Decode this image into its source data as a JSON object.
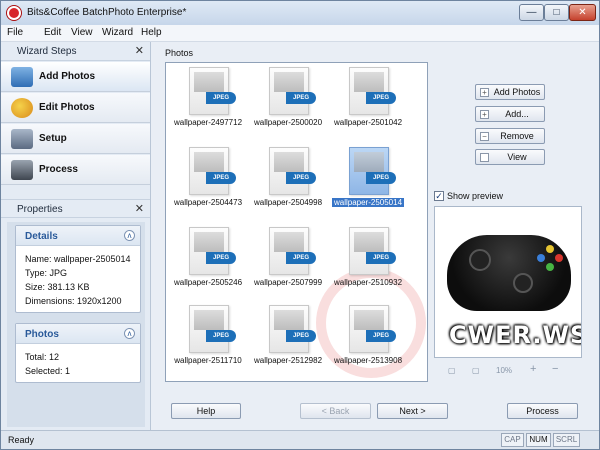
{
  "window": {
    "title": "Bits&Coffee BatchPhoto Enterprise*",
    "min_glyph": "—",
    "max_glyph": "□",
    "close_glyph": "✕"
  },
  "menu": [
    "File",
    "Edit",
    "View",
    "Wizard",
    "Help"
  ],
  "wizard_steps": {
    "title": "Wizard Steps",
    "close_glyph": "✕",
    "steps": [
      {
        "label": "Add Photos",
        "icon": "add-photos-icon",
        "active": true
      },
      {
        "label": "Edit Photos",
        "icon": "edit-photos-icon",
        "active": false
      },
      {
        "label": "Setup",
        "icon": "setup-icon",
        "active": false
      },
      {
        "label": "Process",
        "icon": "process-icon",
        "active": false
      }
    ]
  },
  "properties": {
    "title": "Properties",
    "close_glyph": "✕",
    "details": {
      "title": "Details",
      "collapse_glyph": "ʌ",
      "name": "Name: wallpaper-2505014",
      "type": "Type: JPG",
      "size": "Size: 381.13 KB",
      "dimensions": "Dimensions: 1920x1200"
    },
    "photos": {
      "title": "Photos",
      "collapse_glyph": "ʌ",
      "total": "Total: 12",
      "selected": "Selected: 1"
    }
  },
  "photos": {
    "label": "Photos",
    "badge": "JPEG",
    "items": [
      {
        "name": "wallpaper-2497712",
        "selected": false
      },
      {
        "name": "wallpaper-2500020",
        "selected": false
      },
      {
        "name": "wallpaper-2501042",
        "selected": false
      },
      {
        "name": "wallpaper-2504473",
        "selected": false
      },
      {
        "name": "wallpaper-2504998",
        "selected": false
      },
      {
        "name": "wallpaper-2505014",
        "selected": true
      },
      {
        "name": "wallpaper-2505246",
        "selected": false
      },
      {
        "name": "wallpaper-2507999",
        "selected": false
      },
      {
        "name": "wallpaper-2510932",
        "selected": false
      },
      {
        "name": "wallpaper-2511710",
        "selected": false
      },
      {
        "name": "wallpaper-2512982",
        "selected": false
      },
      {
        "name": "wallpaper-2513908",
        "selected": false
      }
    ]
  },
  "actions": {
    "add_photos": "Add Photos",
    "add": "Add...",
    "remove": "Remove",
    "view": "View"
  },
  "preview": {
    "show_label": "Show preview",
    "checked": true,
    "watermark": "CWER.WS",
    "zoom": "10%"
  },
  "nav": {
    "help": "Help",
    "back": "< Back",
    "next": "Next >",
    "process": "Process"
  },
  "status": {
    "text": "Ready",
    "caps": "CAP",
    "num": "NUM",
    "scroll": "SCRL"
  },
  "colors": {
    "accent": "#3875c7",
    "jpeg_badge": "#1d6fb8",
    "close_button": "#c5412d"
  }
}
